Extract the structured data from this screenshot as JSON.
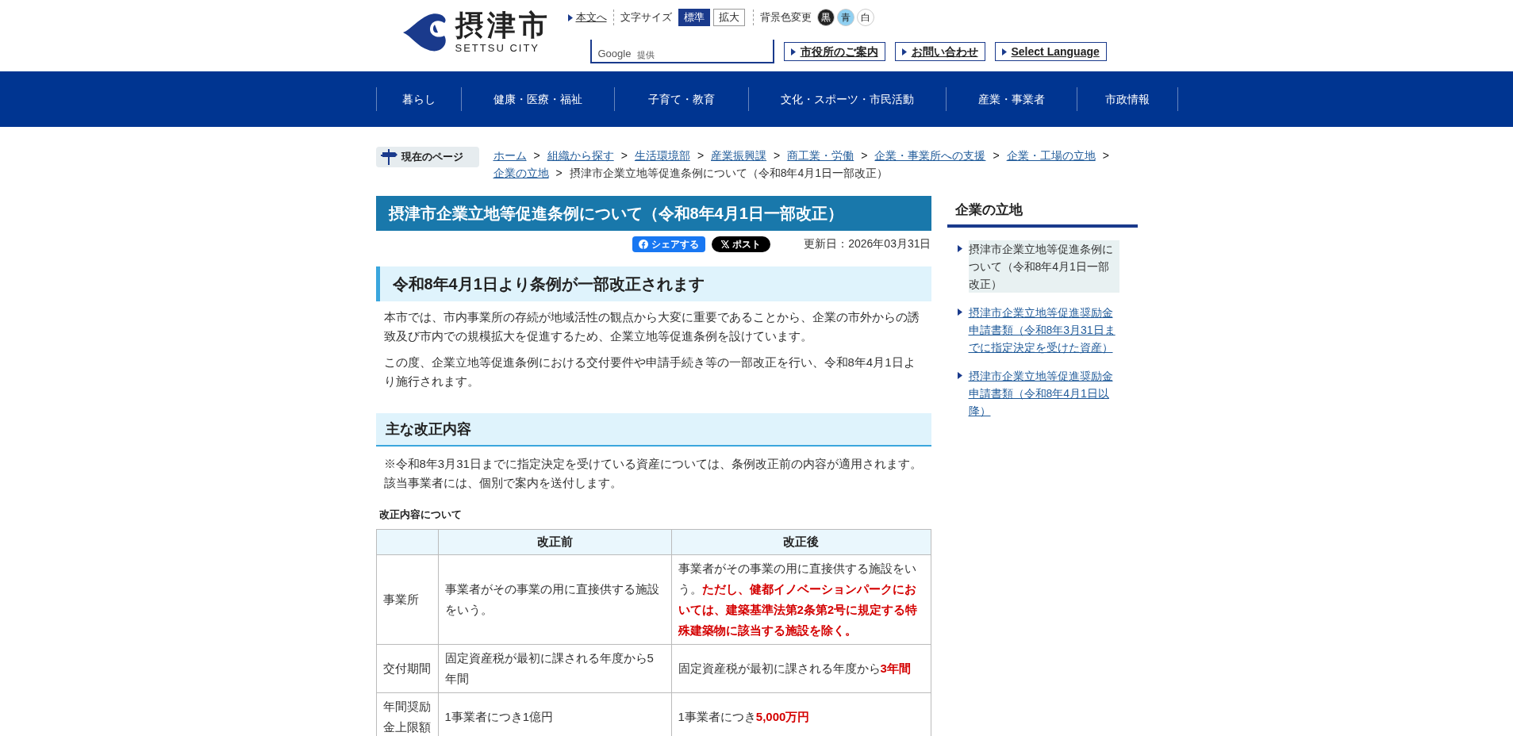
{
  "header": {
    "logo": {
      "name": "摂津市",
      "sub": "SETTSU CITY"
    },
    "skip_link": "本文へ",
    "font_size": {
      "label": "文字サイズ",
      "options": [
        {
          "label": "標準",
          "selected": true
        },
        {
          "label": "拡大",
          "selected": false
        }
      ]
    },
    "bg_color": {
      "label": "背景色変更",
      "options": [
        {
          "label": "黒",
          "color": "#222222"
        },
        {
          "label": "青",
          "color": "#8fd0f2"
        },
        {
          "label": "白",
          "color": "#ffffff"
        }
      ]
    },
    "search": {
      "provider": "Google",
      "note": "提供"
    },
    "links": [
      "市役所のご案内",
      "お問い合わせ",
      "Select Language"
    ]
  },
  "nav": [
    "暮らし",
    "健康・医療・福祉",
    "子育て・教育",
    "文化・スポーツ・市民活動",
    "産業・事業者",
    "市政情報"
  ],
  "breadcrumb": {
    "label": "現在のページ",
    "separator": ">",
    "items": [
      {
        "label": "ホーム",
        "link": true
      },
      {
        "label": "組織から探す",
        "link": true
      },
      {
        "label": "生活環境部",
        "link": true
      },
      {
        "label": "産業振興課",
        "link": true
      },
      {
        "label": "商工業・労働",
        "link": true
      },
      {
        "label": "企業・事業所への支援",
        "link": true
      },
      {
        "label": "企業・工場の立地",
        "link": true
      },
      {
        "label": "企業の立地",
        "link": true
      },
      {
        "label": "摂津市企業立地等促進条例について（令和8年4月1日一部改正）",
        "link": false
      }
    ]
  },
  "article": {
    "title": "摂津市企業立地等促進条例について（令和8年4月1日一部改正）",
    "share": [
      {
        "kind": "facebook",
        "label": "シェアする"
      },
      {
        "kind": "x",
        "label": "ポスト"
      }
    ],
    "updated": "更新日：2026年03月31日",
    "blocks": [
      {
        "kind": "h2",
        "text": "令和8年4月1日より条例が一部改正されます"
      },
      {
        "kind": "p",
        "text": "本市では、市内事業所の存続が地域活性の観点から大変に重要であることから、企業の市外からの誘致及び市内での規模拡大を促進するため、企業立地等促進条例を設けています。"
      },
      {
        "kind": "p",
        "text": "この度、企業立地等促進条例における交付要件や申請手続き等の一部改正を行い、令和8年4月1日より施行されます。"
      },
      {
        "kind": "h3",
        "text": "主な改正内容"
      },
      {
        "kind": "p",
        "text": "※令和8年3月31日までに指定決定を受けている資産については、条例改正前の内容が適用されます。該当事業者には、個別で案内を送付します。"
      },
      {
        "kind": "caption",
        "text": "改正内容について"
      }
    ],
    "table": {
      "columns": [
        "改正前",
        "改正後"
      ],
      "rows": [
        {
          "label": "事業所",
          "before": "事業者がその事業の用に直接供する施設をいう。",
          "after": "事業者がその事業の用に直接供する施設をいう。**ただし、健都イノベーションパークにおいては、建築基準法第2条第2号に規定する特殊建築物に該当する施設を除く。**"
        },
        {
          "label": "交付期間",
          "before": "固定資産税が最初に課される年度から5年間",
          "after": "固定資産税が最初に課される年度から**3年間**"
        },
        {
          "label": "年間奨励金上限額",
          "before": "1事業者につき1億円",
          "after": "1事業者につき**5,000万円**"
        }
      ]
    }
  },
  "sidebar": {
    "heading": "企業の立地",
    "items": [
      {
        "label": "摂津市企業立地等促進条例について（令和8年4月1日一部改正）",
        "selected": true
      },
      {
        "label": "摂津市企業立地等促進奨励金申請書類（令和8年3月31日までに指定決定を受けた資産）",
        "selected": false
      },
      {
        "label": "摂津市企業立地等促進奨励金申請書類（令和8年4月1日以降）",
        "selected": false
      }
    ]
  }
}
